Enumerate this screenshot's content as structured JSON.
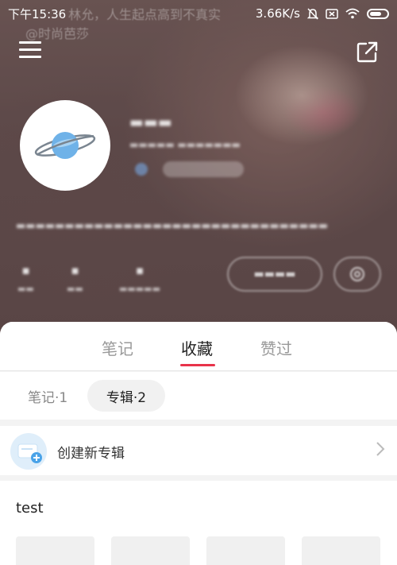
{
  "status_bar": {
    "time": "下午15:36",
    "network_speed": "3.66K/s",
    "icons": [
      "alarm-off-icon",
      "sim-icon",
      "wifi-icon",
      "battery-icon"
    ]
  },
  "background_notification": {
    "line1": "林允，人生起点高到不真实",
    "line2": "@时尚芭莎"
  },
  "header": {
    "menu_icon": "hamburger-menu-icon",
    "share_icon": "share-icon"
  },
  "profile": {
    "avatar_icon": "planet-icon"
  },
  "tabs": [
    {
      "label": "笔记",
      "active": false
    },
    {
      "label": "收藏",
      "active": true
    },
    {
      "label": "赞过",
      "active": false
    }
  ],
  "subtabs": [
    {
      "label": "笔记·1",
      "active": false
    },
    {
      "label": "专辑·2",
      "active": true
    }
  ],
  "create_album": {
    "label": "创建新专辑"
  },
  "album": {
    "title": "test"
  },
  "colors": {
    "accent": "#e8334a",
    "create_icon_bg": "#dfeefa"
  }
}
